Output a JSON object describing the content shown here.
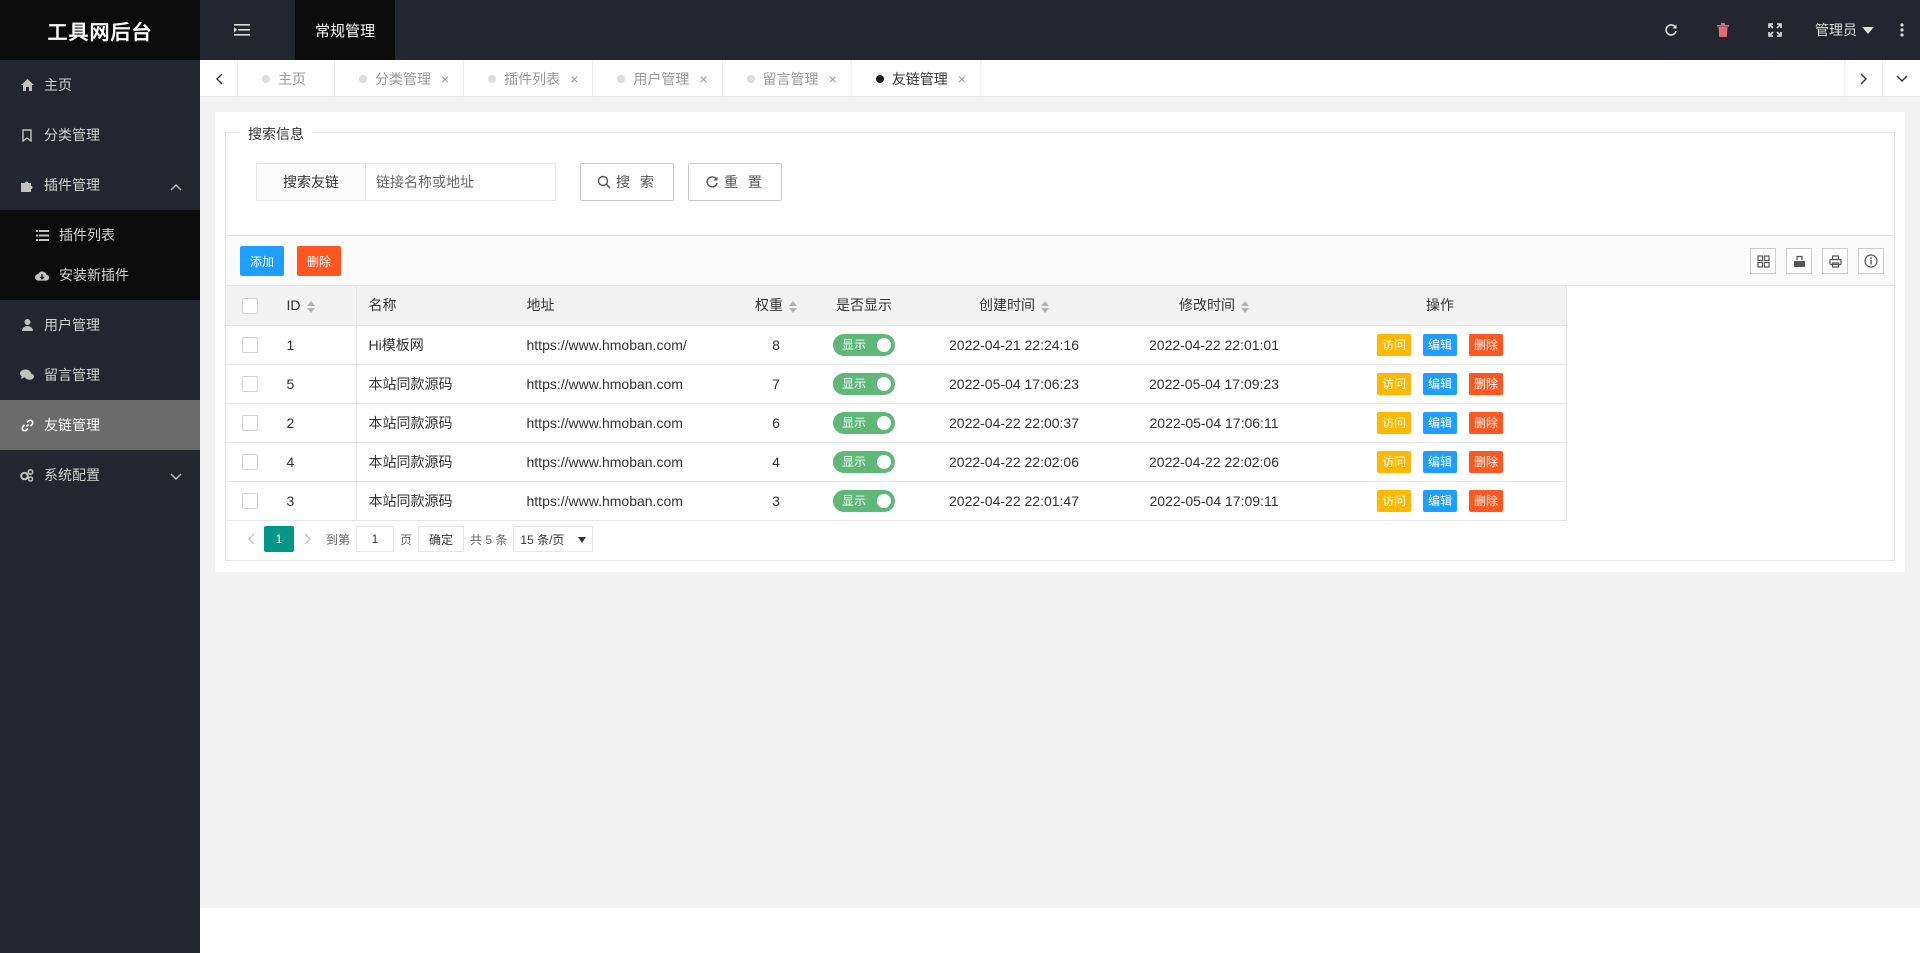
{
  "app": {
    "title": "工具网后台"
  },
  "header": {
    "module_tab": "常规管理",
    "admin_label": "管理员",
    "icons": [
      "refresh-icon",
      "trash-icon",
      "fullscreen-icon",
      "more-vertical-icon"
    ]
  },
  "sidebar": {
    "items": [
      {
        "label": "主页",
        "icon": "home-icon"
      },
      {
        "label": "分类管理",
        "icon": "bookmark-icon"
      },
      {
        "label": "插件管理",
        "icon": "puzzle-icon",
        "expanded": true,
        "children": [
          {
            "label": "插件列表",
            "icon": "list-icon"
          },
          {
            "label": "安装新插件",
            "icon": "cloud-download-icon"
          }
        ]
      },
      {
        "label": "用户管理",
        "icon": "user-icon"
      },
      {
        "label": "留言管理",
        "icon": "chat-icon"
      },
      {
        "label": "友链管理",
        "icon": "link-icon",
        "active": true
      },
      {
        "label": "系统配置",
        "icon": "gears-icon"
      }
    ]
  },
  "tabs": [
    {
      "label": "主页"
    },
    {
      "label": "分类管理"
    },
    {
      "label": "插件列表"
    },
    {
      "label": "用户管理"
    },
    {
      "label": "留言管理"
    },
    {
      "label": "友链管理",
      "active": true
    }
  ],
  "search": {
    "legend": "搜索信息",
    "field_label": "搜索友链",
    "placeholder": "链接名称或地址",
    "value": "",
    "search_button": "搜 索",
    "reset_button": "重 置"
  },
  "toolbar": {
    "add_label": "添加",
    "delete_label": "删除"
  },
  "table": {
    "headers": {
      "id": "ID",
      "name": "名称",
      "url": "地址",
      "weight": "权重",
      "visible": "是否显示",
      "created": "创建时间",
      "modified": "修改时间",
      "actions": "操作"
    },
    "rows": [
      {
        "id": "1",
        "name": "Hi模板网",
        "url": "https://www.hmoban.com/",
        "weight": "8",
        "visible": "显示",
        "created": "2022-04-21 22:24:16",
        "modified": "2022-04-22 22:01:01"
      },
      {
        "id": "5",
        "name": "本站同款源码",
        "url": "https://www.hmoban.com",
        "weight": "7",
        "visible": "显示",
        "created": "2022-05-04 17:06:23",
        "modified": "2022-05-04 17:09:23"
      },
      {
        "id": "2",
        "name": "本站同款源码",
        "url": "https://www.hmoban.com",
        "weight": "6",
        "visible": "显示",
        "created": "2022-04-22 22:00:37",
        "modified": "2022-05-04 17:06:11"
      },
      {
        "id": "4",
        "name": "本站同款源码",
        "url": "https://www.hmoban.com",
        "weight": "4",
        "visible": "显示",
        "created": "2022-04-22 22:02:06",
        "modified": "2022-04-22 22:02:06"
      },
      {
        "id": "3",
        "name": "本站同款源码",
        "url": "https://www.hmoban.com",
        "weight": "3",
        "visible": "显示",
        "created": "2022-04-22 22:01:47",
        "modified": "2022-05-04 17:09:11"
      }
    ],
    "row_actions": {
      "visit": "访问",
      "edit": "编辑",
      "delete": "删除"
    }
  },
  "pagination": {
    "current_page": "1",
    "goto_label": "到第",
    "goto_value": "1",
    "page_unit": "页",
    "confirm": "确定",
    "total": "共 5 条",
    "page_size": "15 条/页"
  },
  "colors": {
    "header_bg": "#23262e",
    "active_nav": "#6b6b6b",
    "primary_blue": "#1e9fff",
    "danger": "#ff5722",
    "warn": "#ffb800",
    "switch_on": "#5fb878",
    "pager_active": "#009688"
  }
}
